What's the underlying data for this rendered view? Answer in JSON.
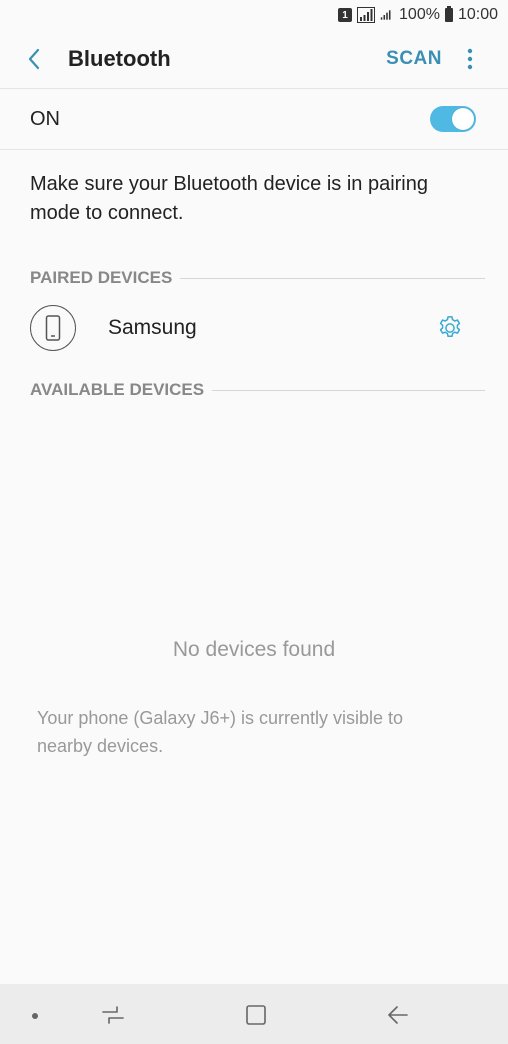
{
  "status_bar": {
    "sim_label": "1",
    "battery": "100%",
    "time": "10:00"
  },
  "header": {
    "title": "Bluetooth",
    "scan_label": "SCAN"
  },
  "toggle": {
    "label": "ON",
    "state": "on"
  },
  "description": "Make sure your Bluetooth device is in pairing mode to connect.",
  "paired": {
    "header": "PAIRED DEVICES",
    "devices": [
      {
        "name": "Samsung",
        "icon": "phone-icon"
      }
    ]
  },
  "available": {
    "header": "AVAILABLE DEVICES",
    "empty_message": "No devices found",
    "visibility_note": "Your phone (Galaxy J6+) is currently visible to nearby devices."
  },
  "colors": {
    "accent": "#3a8fb5",
    "toggle_on": "#4fb9e3",
    "background": "#fafafa"
  },
  "icons": {
    "back": "chevron-left-icon",
    "more": "more-vertical-icon",
    "settings": "gear-icon",
    "nav_recent": "recent-apps-icon",
    "nav_home": "home-icon",
    "nav_back": "back-arrow-icon"
  }
}
